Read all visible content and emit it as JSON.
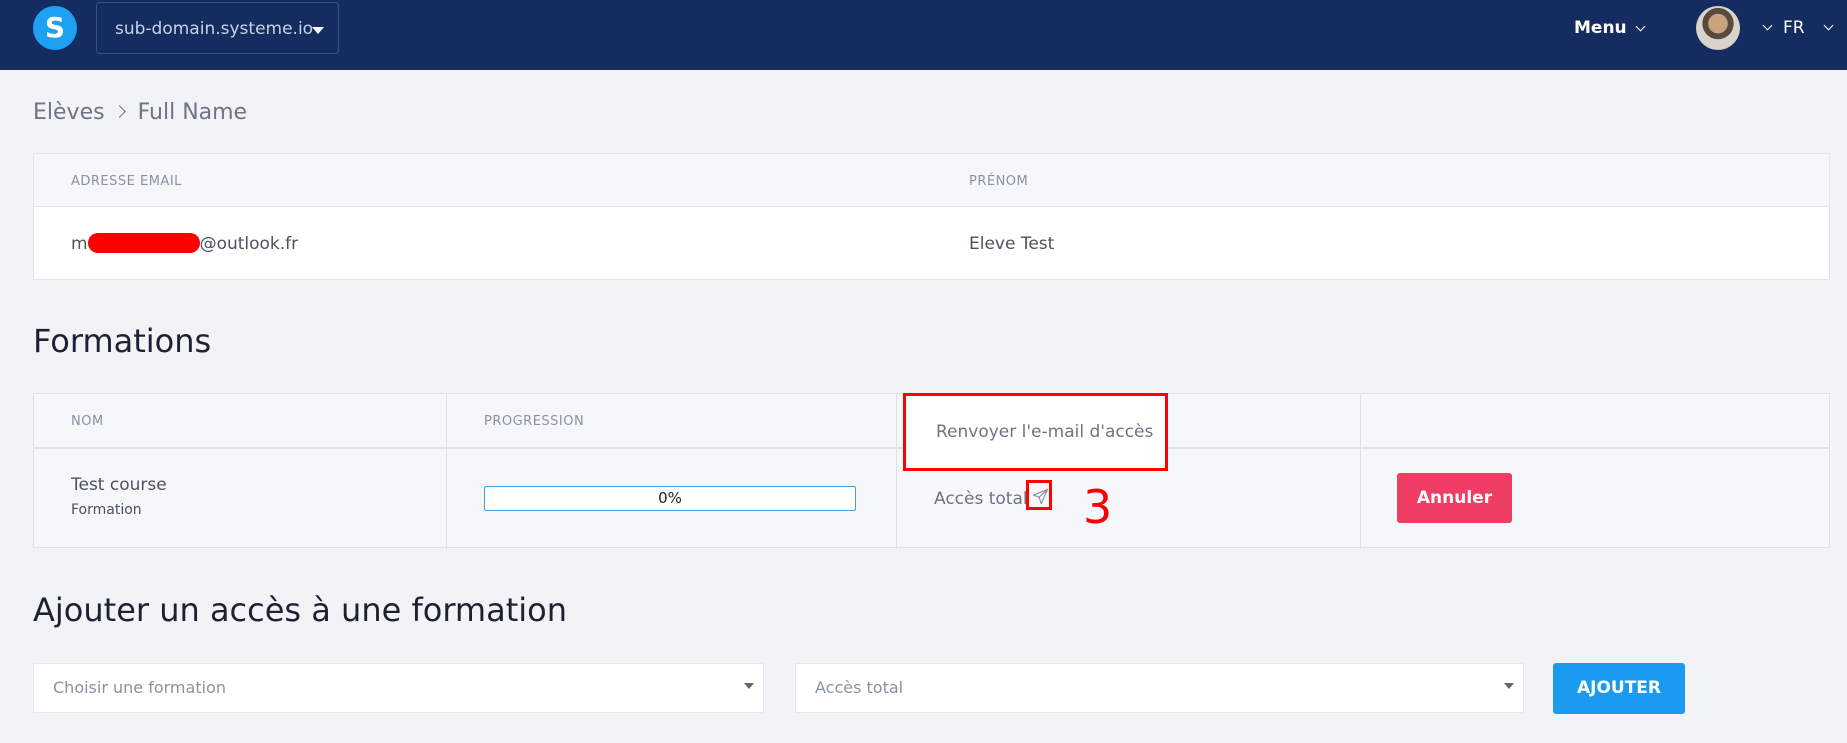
{
  "header": {
    "logo_letter": "S",
    "domain": "sub-domain.systeme.io",
    "menu_label": "Menu",
    "language": "FR"
  },
  "breadcrumb": {
    "parent": "Elèves",
    "current": "Full Name"
  },
  "student": {
    "columns": [
      "ADRESSE EMAIL",
      "PRÉNOM"
    ],
    "email_prefix": "m",
    "email_suffix": "@outlook.fr",
    "first_name": "Eleve Test"
  },
  "formations": {
    "title": "Formations",
    "columns": [
      "NOM",
      "PROGRESSION"
    ],
    "rows": [
      {
        "name": "Test course",
        "type": "Formation",
        "progress": "0%",
        "progress_value": 0,
        "access": "Accès total",
        "cancel_label": "Annuler"
      }
    ],
    "tooltip": "Renvoyer l'e-mail d'accès",
    "annotation": "3"
  },
  "add_access": {
    "title": "Ajouter un accès à une formation",
    "course_placeholder": "Choisir une formation",
    "access_value": "Accès total",
    "add_label": "AJOUTER"
  },
  "colors": {
    "topbar": "#142c5f",
    "accent_blue": "#1b9bf0",
    "danger": "#ef3d63",
    "annotation_red": "#ff0000"
  },
  "icons": [
    "logo-icon",
    "caret-down-icon",
    "chevron-down-icon",
    "chevron-right-icon",
    "send-icon"
  ]
}
